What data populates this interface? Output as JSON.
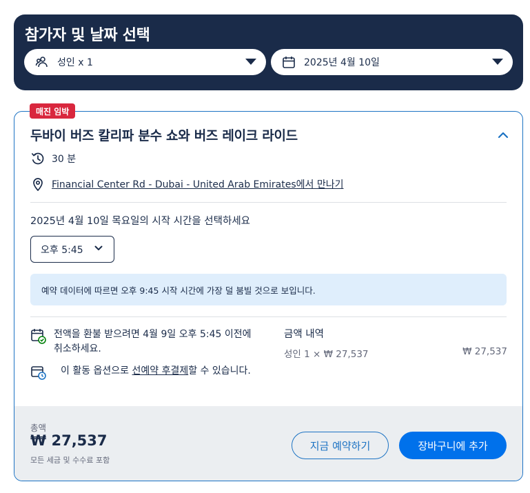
{
  "picker": {
    "title": "참가자 및 날짜 선택",
    "travelers": "성인 x 1",
    "date": "2025년 4월 10일"
  },
  "badge": "매진 임박",
  "activity": {
    "title": "두바이 버즈 칼리파 분수 쇼와 버즈 레이크 라이드",
    "duration": "30 분",
    "meeting_point_link": "Financial Center Rd - Dubai - United Arab Emirates",
    "meeting_point_suffix": "에서 만나기"
  },
  "start_time": {
    "prompt": "2025년 4월 10일 목요일의 시작 시간을 선택하세요",
    "selected": "오후 5:45",
    "info": "예약 데이터에 따르면 오후 9:45 시작 시간에 가장 덜 붐빌 것으로 보입니다."
  },
  "policy": {
    "refund": "전액을 환불 받으려면 4월 9일 오후 5:45 이전에 취소하세요.",
    "pay_prefix": "이 활동 옵션으로 ",
    "pay_link": "선예약 후결제",
    "pay_suffix": "할 수 있습니다."
  },
  "price_breakdown": {
    "title": "금액 내역",
    "line_label": "성인 1 × ₩ 27,537",
    "line_amount": "₩ 27,537"
  },
  "footer": {
    "total_label": "총액",
    "total_value": "₩ 27,537",
    "total_note": "모든 세금 및 수수료 포함",
    "reserve_label": "지금 예약하기",
    "cart_label": "장바구니에 추가"
  },
  "colors": {
    "navy": "#1a2b49",
    "primary_blue": "#0071eb",
    "border_blue": "#1b72c3",
    "badge_red": "#d9273e",
    "info_bg": "#dfeefc",
    "footer_bg": "#ebeef1"
  },
  "icons": {
    "travelers": "people-icon",
    "date": "calendar-icon",
    "duration": "clock-icon",
    "meeting": "location-pin-icon",
    "refund": "calendar-check-icon",
    "pay_later": "calendar-clock-icon"
  }
}
